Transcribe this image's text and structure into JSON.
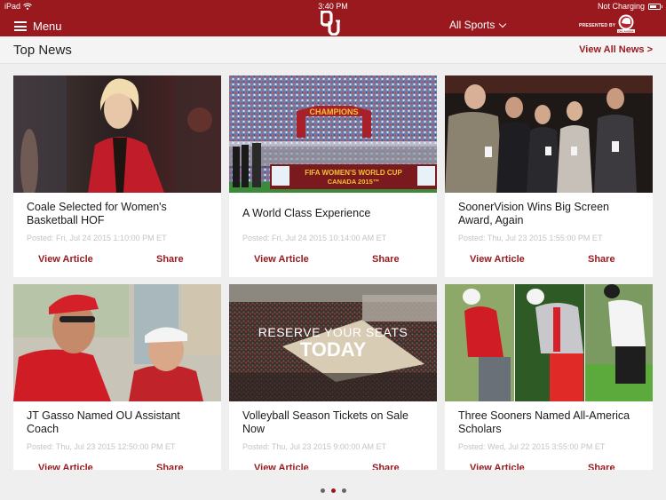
{
  "status_bar": {
    "device": "iPad",
    "time": "3:40 PM",
    "battery_status": "Not Charging",
    "wifi_icon": "wifi-icon",
    "battery_icon": "battery-icon"
  },
  "nav": {
    "menu_label": "Menu",
    "menu_icon": "hamburger-icon",
    "logo": "OU",
    "sports_selector": "All Sports",
    "presented_by": "PRESENTED BY",
    "sponsor": "OKLAHOMA",
    "brand_color": "#99191e"
  },
  "section": {
    "title": "Top News",
    "view_all": "View All News >"
  },
  "articles": [
    {
      "title": "Coale Selected for Women's Basketball HOF",
      "posted": "Posted: Fri, Jul 24 2015 1:10:00 PM ET",
      "view": "View Article",
      "share": "Share"
    },
    {
      "title": "A World Class Experience",
      "posted": "Posted: Fri, Jul 24 2015 10:14:00 AM ET",
      "view": "View Article",
      "share": "Share",
      "image_text": [
        "CHAMPIONS",
        "FIFA WOMEN'S WORLD CUP",
        "CANADA 2015™"
      ]
    },
    {
      "title": "SoonerVision Wins Big Screen Award, Again",
      "posted": "Posted: Thu, Jul 23 2015 1:55:00 PM ET",
      "view": "View Article",
      "share": "Share"
    },
    {
      "title": "JT Gasso Named OU Assistant Coach",
      "posted": "Posted: Thu, Jul 23 2015 12:50:00 PM ET",
      "view": "View Article",
      "share": "Share"
    },
    {
      "title": "Volleyball Season Tickets on Sale Now",
      "posted": "Posted: Thu, Jul 23 2015 9:00:00 AM ET",
      "view": "View Article",
      "share": "Share",
      "image_text": [
        "RESERVE YOUR SEATS",
        "TODAY"
      ]
    },
    {
      "title": "Three Sooners Named All-America Scholars",
      "posted": "Posted: Wed, Jul 22 2015 3:55:00 PM ET",
      "view": "View Article",
      "share": "Share"
    }
  ],
  "pagination": {
    "pages": 3,
    "current": 2
  }
}
